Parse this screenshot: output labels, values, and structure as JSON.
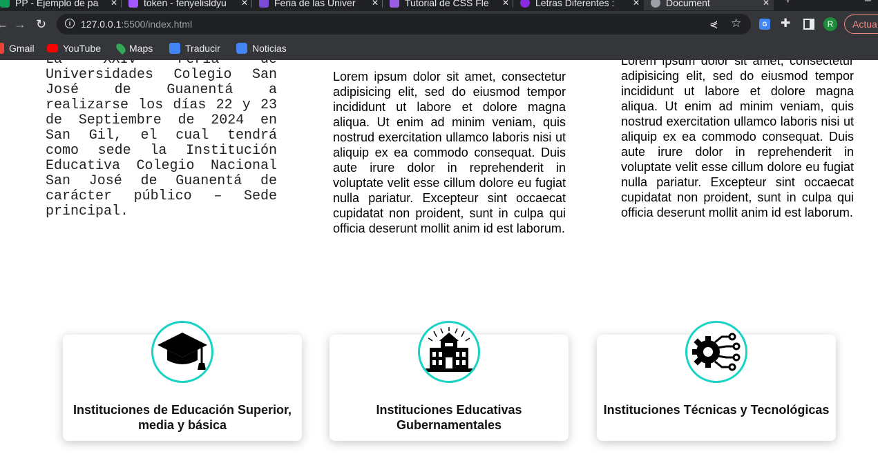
{
  "browser": {
    "tabs": [
      {
        "label": "PP - Ejemplo de pa",
        "icon": "sheets-icon",
        "color": "#0f9d58"
      },
      {
        "label": "token - fenyelisldyu",
        "icon": "figma-icon",
        "color": "#a259ff"
      },
      {
        "label": "Feria de las Univer",
        "icon": "image-icon",
        "color": "#7b4bd6"
      },
      {
        "label": "Tutorial de CSS Fle",
        "icon": "w-icon",
        "color": "#9b5de5"
      },
      {
        "label": "Letras Diferentes :",
        "icon": "letters-icon",
        "color": "#8a2be2"
      },
      {
        "label": "Document",
        "icon": "globe-icon",
        "color": "#9aa0a6"
      }
    ],
    "close_glyph": "✕",
    "new_tab_glyph": "+",
    "menu_glyph": "–",
    "url_host": "127.0.0.1",
    "url_rest": ":5500/index.html",
    "update_label": "Actua",
    "avatar_letter": "R",
    "bookmarks": [
      {
        "label": "Gmail",
        "icon": "gmail-icon",
        "color": "#ea4335"
      },
      {
        "label": "YouTube",
        "icon": "youtube-icon",
        "color": "#ff0000"
      },
      {
        "label": "Maps",
        "icon": "maps-icon",
        "color": "#34a853"
      },
      {
        "label": "Traducir",
        "icon": "translate-icon",
        "color": "#4285f4"
      },
      {
        "label": "Noticias",
        "icon": "news-icon",
        "color": "#4285f4"
      }
    ]
  },
  "content": {
    "col1": "La XXIV Feria de Universidades Colegio San José de Guanentá a realizarse los días 22 y 23 de Septiembre de 2024 en San Gil, el cual tendrá como sede la Institución Educativa Colegio Nacional San José de Guanentá de carácter público – Sede principal.",
    "col2": "Lorem ipsum dolor sit amet, consectetur adipisicing elit, sed do eiusmod tempor incididunt ut labore et dolore magna aliqua. Ut enim ad minim veniam, quis nostrud exercitation ullamco laboris nisi ut aliquip ex ea commodo consequat. Duis aute irure dolor in reprehenderit in voluptate velit esse cillum dolore eu fugiat nulla pariatur. Excepteur sint occaecat cupidatat non proident, sunt in culpa qui officia deserunt mollit anim id est laborum.",
    "col3": "Lorem ipsum dolor sit amet, consectetur adipisicing elit, sed do eiusmod tempor incididunt ut labore et dolore magna aliqua. Ut enim ad minim veniam, quis nostrud exercitation ullamco laboris nisi ut aliquip ex ea commodo consequat. Duis aute irure dolor in reprehenderit in voluptate velit esse cillum dolore eu fugiat nulla pariatur. Excepteur sint occaecat cupidatat non proident, sunt in culpa qui officia deserunt mollit anim id est laborum."
  },
  "cards": [
    {
      "title": "Instituciones de Educación Superior, media y básica",
      "icon": "graduation-cap-icon"
    },
    {
      "title": "Instituciones Educativas Gubernamentales",
      "icon": "government-building-icon"
    },
    {
      "title": "Instituciones Técnicas y Tecnológicas",
      "icon": "gear-circuit-icon"
    }
  ],
  "colors": {
    "accent": "#19d3c5",
    "chrome_dark": "#202124",
    "chrome": "#35363a"
  }
}
